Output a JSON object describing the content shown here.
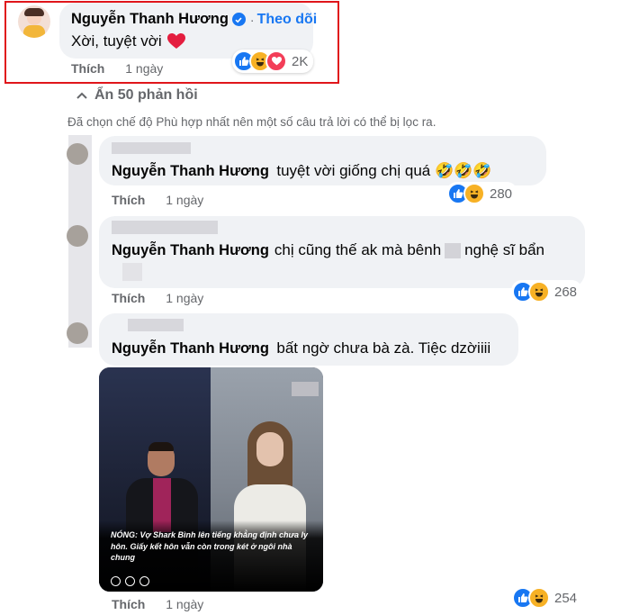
{
  "top_comment": {
    "author": "Nguyễn Thanh Hương",
    "follow": "Theo dõi",
    "separator": "·",
    "text": "Xời, tuyệt vời",
    "like_label": "Thích",
    "time": "1 ngày",
    "reaction_count": "2K",
    "reactions": [
      "like-icon",
      "haha-icon",
      "love-icon"
    ]
  },
  "highlight_color": "#e0161b",
  "hide_replies": "Ẩn 50 phản hồi",
  "filter_notice": "Đã chọn chế độ Phù hợp nhất nên một số câu trả lời có thể bị lọc ra.",
  "replies": [
    {
      "mention": "Nguyễn Thanh Hương",
      "text": "tuyệt vời giống chị quá 🤣🤣🤣",
      "like_label": "Thích",
      "time": "1 ngày",
      "reaction_count": "280"
    },
    {
      "mention": "Nguyễn Thanh Hương",
      "text_a": "chị cũng thế ak mà bênh",
      "text_b": "nghệ sĩ bẩn",
      "like_label": "Thích",
      "time": "1 ngày",
      "reaction_count": "268"
    },
    {
      "mention": "Nguyễn Thanh Hương",
      "text": "bất ngờ chưa bà zà. Tiệc dzờiiii",
      "like_label": "Thích",
      "time": "1 ngày",
      "reaction_count": "254"
    }
  ],
  "attachment": {
    "headline": "NÓNG: Vợ Shark Bình lên tiếng khẳng định chưa ly hôn. Giấy kết hôn vẫn còn trong két ở ngôi nhà chung"
  },
  "colors": {
    "accent": "#1877f2",
    "bubble": "#f0f2f5",
    "secondary_text": "#65676b"
  }
}
